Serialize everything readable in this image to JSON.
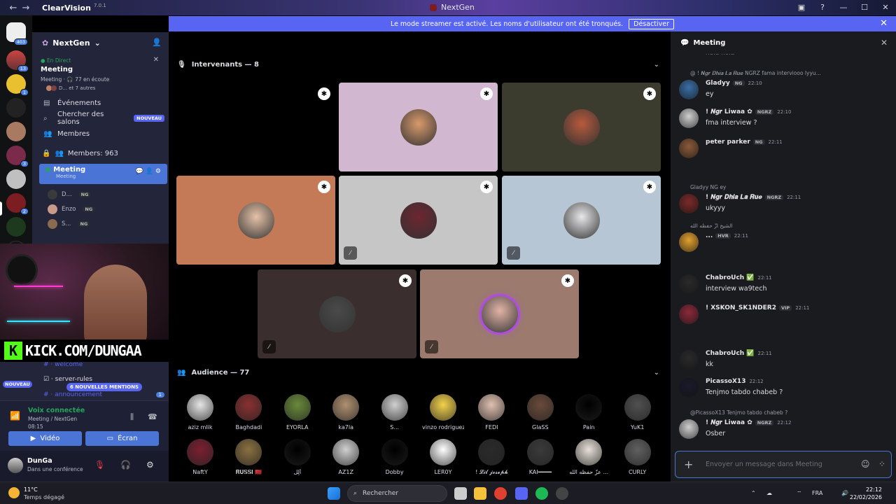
{
  "window": {
    "app_name": "ClearVision",
    "version": "7.0.1",
    "center_title": "NextGen",
    "back": "←",
    "forward": "→"
  },
  "banner": {
    "text": "Le mode streamer est activé. Les noms d'utilisateur ont été tronqués.",
    "button": "Désactiver",
    "close": "✕"
  },
  "guilds": {
    "home_badge": "403",
    "badges": [
      "13",
      "1",
      "3",
      "2",
      "6"
    ]
  },
  "sidebar": {
    "server_name": "NextGen",
    "live_label": "En Direct",
    "live_title": "Meeting",
    "live_sub": "Meeting · 🎧 77 en écoute",
    "live_people": "D... et 7 autres",
    "menu": [
      {
        "icon": "calendar-icon",
        "label": "Événements",
        "glyph": "▤"
      },
      {
        "icon": "search-channels-icon",
        "label": "Chercher des salons",
        "glyph": "⌕",
        "badge": "NOUVEAU"
      },
      {
        "icon": "members-icon",
        "label": "Membres",
        "glyph": "👥"
      }
    ],
    "members_label": "Members: 963",
    "active_channel": {
      "name": "Meeting",
      "sub": "Meeting"
    },
    "voice_users": [
      {
        "name": "D...",
        "tag": "NG",
        "color": "#3a3a3a"
      },
      {
        "name": "Enzo",
        "tag": "NG",
        "color": "#c89a8a"
      },
      {
        "name": "S...",
        "tag": "NG",
        "color": "#8a6b4f"
      }
    ],
    "channels": [
      {
        "name": "welcome"
      },
      {
        "name": "server-rules"
      },
      {
        "name": "announcement",
        "badge": "1"
      }
    ],
    "new_label": "NOUVEAU",
    "mentions_badge": "6 NOUVELLES MENTIONS"
  },
  "stream_overlay": {
    "kick_url": "KICK.COM/DUNGAA",
    "kick_letter": "K"
  },
  "voice": {
    "connected": "Voix connectée",
    "channel": "Meeting / NextGen",
    "time": "08:15",
    "video_btn": "Vidéo",
    "screen_btn": "Écran"
  },
  "user": {
    "name": "DunGa",
    "status": "Dans une conférence"
  },
  "stage": {
    "speakers_header": "Intervenants — 8",
    "audience_header": "Audience — 77",
    "tiles": [
      {
        "bg": "#000000",
        "avatar": null,
        "muted": false
      },
      {
        "bg": "#d1b7d0",
        "avatar": "#d99a6c",
        "muted": false
      },
      {
        "bg": "#3c3c2e",
        "avatar": "#b85a3c",
        "muted": false
      },
      {
        "bg": "#c47a57",
        "avatar": "#e6c2a8",
        "muted": false
      },
      {
        "bg": "#c6c6c6",
        "avatar": "#6e2530",
        "muted": true
      },
      {
        "bg": "#b6c6d4",
        "avatar": "#e8e8ea",
        "muted": true
      },
      {
        "bg": "#3b2e2e",
        "avatar": "#4a4a4a",
        "muted": true
      },
      {
        "bg": "#9c7a6e",
        "avatar": "#e2b4a6",
        "muted": true,
        "speaking": true
      }
    ],
    "audience": [
      {
        "name": "aziz mlik",
        "color": "#e6e6e6"
      },
      {
        "name": "Baghdadi",
        "color": "#8a3030"
      },
      {
        "name": "EYORLA",
        "color": "#6a8a3a"
      },
      {
        "name": "ka7la",
        "color": "#b09070"
      },
      {
        "name": "S...",
        "color": "#d0d0d0"
      },
      {
        "name": "vinzo rodriguez",
        "color": "#f2d24a"
      },
      {
        "name": "FEDI",
        "color": "#e0c0b0"
      },
      {
        "name": "GlaSS",
        "color": "#6a4a3a"
      },
      {
        "name": "Pain",
        "color": "#000000"
      },
      {
        "name": "YuK1",
        "color": "#505050"
      },
      {
        "name": "NaftY",
        "color": "#7a2030"
      },
      {
        "name": "𝐑𝐔𝐒𝐒𝐈 🇲🇦",
        "color": "#8a7040"
      },
      {
        "name": "أُلِل",
        "color": "#000000"
      },
      {
        "name": "AZ1Z",
        "color": "#d0d0d0"
      },
      {
        "name": "Dobby",
        "color": "#000000"
      },
      {
        "name": "LER0Y",
        "color": "#ffffff"
      },
      {
        "name": "! 𝓛𝓲𝓵 𝓳𝓸𝓼𝓮𝓹𝓱",
        "color": "#2a2a2a"
      },
      {
        "name": "KAI━━━━",
        "color": "#3a3a3a"
      },
      {
        "name": "عزّ حفظه الله ...",
        "color": "#e8e0d8"
      },
      {
        "name": "CURLY",
        "color": "#606060"
      }
    ]
  },
  "chat": {
    "title": "Meeting",
    "top_fragment": "hola hola",
    "messages": [
      {
        "reply": "@ ! 𝑵𝒈𝒓 𝑫𝒉𝒊𝒂 𝑳𝒂 𝑹𝒖𝒆 NGRZ fama interviooo lyyu...",
        "name": "Gladyy",
        "tag": "NG",
        "time": "22:10",
        "text": "ey",
        "color": "#3a6ea5"
      },
      {
        "reply": "",
        "name": "! 𝑵𝒈𝒓 Liwaa ✿",
        "tag": "NGRZ",
        "time": "22:10",
        "text": "fma interview ?",
        "color": "#cfcfcf"
      },
      {
        "reply": "",
        "name": "peter parker",
        "tag": "NG",
        "time": "22:11",
        "text": "",
        "color": "#8a5a3a"
      },
      {
        "reply": "Gladyy  NG  ey",
        "name": "! 𝑵𝒈𝒓 𝑫𝒉𝒊𝒂 𝑳𝒂 𝑹𝒖𝒆",
        "tag": "NGRZ",
        "time": "22:11",
        "text": "ukyyy",
        "color": "#7a2a2a"
      },
      {
        "reply": "الشيخ ازّ حفظه الله",
        "name": "...",
        "tag": "HVR",
        "time": "22:11",
        "text": "",
        "color": "#e0a030"
      },
      {
        "reply": "",
        "name": "ChabroUch ✅",
        "tag": "",
        "time": "22:11",
        "text": "interview wa9tech",
        "color": "#2a2a2a"
      },
      {
        "reply": "",
        "name": "!       XSKON_SK1NDER2",
        "tag": "VIP",
        "time": "22:11",
        "text": "",
        "color": "#8a2a3a"
      },
      {
        "reply": "",
        "name": "ChabroUch ✅",
        "tag": "",
        "time": "22:11",
        "text": "kk",
        "color": "#2a2a2a"
      },
      {
        "reply": "",
        "name": "PicassoX13",
        "tag": "",
        "time": "22:12",
        "text": "Tenjmo tabdo chabeb ?",
        "color": "#1a1a2a"
      },
      {
        "reply": "@PicassoX13 Tenjmo tabdo chabeb ?",
        "name": "! 𝑵𝒈𝒓 Liwaa ✿",
        "tag": "NGRZ",
        "time": "22:12",
        "text": "Osber",
        "color": "#cfcfcf"
      }
    ],
    "composer_placeholder": "Envoyer un message dans Meeting"
  },
  "taskbar": {
    "temp": "11°C",
    "weather": "Temps dégagé",
    "search": "Rechercher",
    "lang": "FRA",
    "time": "22:12",
    "date": "22/02/2026"
  }
}
